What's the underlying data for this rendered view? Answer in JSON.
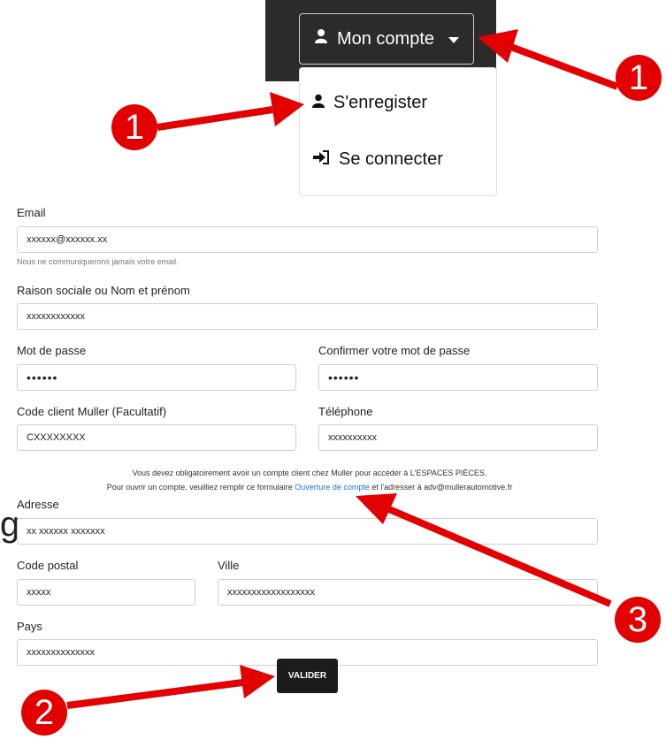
{
  "header": {
    "account_button": "Mon compte"
  },
  "dropdown": {
    "items": [
      {
        "label": "S'enregister"
      },
      {
        "label": "Se connecter"
      }
    ]
  },
  "form": {
    "email": {
      "label": "Email",
      "value": "xxxxxx@xxxxxx.xx",
      "hint": "Nous ne communiquerons jamais votre email."
    },
    "company": {
      "label": "Raison sociale ou Nom et prénom",
      "value": "xxxxxxxxxxxx"
    },
    "password": {
      "label": "Mot de passe",
      "value": "••••••"
    },
    "password_confirm": {
      "label": "Confirmer votre mot de passe",
      "value": "••••••"
    },
    "client_code": {
      "label": "Code client Muller (Facultatif)",
      "value": "CXXXXXXXX"
    },
    "phone": {
      "label": "Téléphone",
      "value": "xxxxxxxxxx"
    },
    "notice_line1": "Vous devez obligatoirement avoir un compte client chez Muller pour accéder à L'ESPACES PIÈCES.",
    "notice_line2_before": "Pour ouvrir un compte, veuilliez remplir ce formulaire",
    "notice_link": "Ouverture de compte",
    "notice_line2_after": "et l'adresser à adv@mullerautomotive.fr",
    "address": {
      "label": "Adresse",
      "value": "xx xxxxxx xxxxxxx"
    },
    "postal_code": {
      "label": "Code postal",
      "value": "xxxxx"
    },
    "city": {
      "label": "Ville",
      "value": "xxxxxxxxxxxxxxxxxx"
    },
    "country": {
      "label": "Pays",
      "value": "xxxxxxxxxxxxxx"
    },
    "submit": "VALIDER"
  },
  "annotations": {
    "badge_1a": "1",
    "badge_1b": "1",
    "badge_2": "2",
    "badge_3": "3",
    "stray_letter": "g",
    "color": "#e30000"
  }
}
